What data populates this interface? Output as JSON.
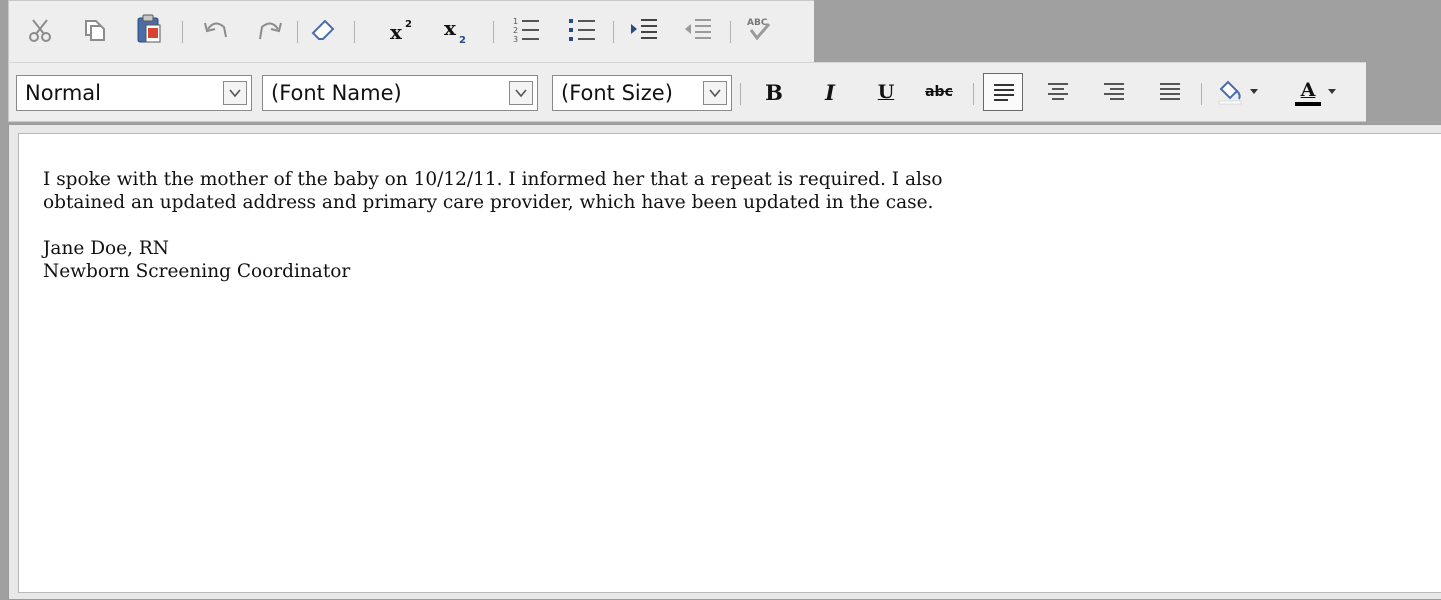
{
  "toolbar": {
    "row1": {
      "icons": [
        "cut-icon",
        "copy-icon",
        "paste-icon",
        "undo-icon",
        "redo-icon",
        "remove-format-icon",
        "superscript-icon",
        "subscript-icon",
        "ordered-list-icon",
        "unordered-list-icon",
        "indent-icon",
        "outdent-icon",
        "spellcheck-icon"
      ]
    },
    "row2": {
      "paragraph_select": "Normal",
      "font_name_select": "(Font Name)",
      "font_size_select": "(Font Size)",
      "bold_label": "B",
      "italic_label": "I",
      "underline_label": "U",
      "strikethrough_label": "abc",
      "font_color_label": "A",
      "font_color": "#000000",
      "highlight_color": "#ffffff"
    },
    "spellcheck_label": "ABC"
  },
  "editor": {
    "lines": [
      "I spoke with the mother of the baby on 10/12/11. I informed her that a repeat is required. I also",
      "obtained an updated address and primary care provider, which have been updated in the case.",
      "",
      "Jane Doe, RN",
      "Newborn Screening Coordinator"
    ]
  }
}
